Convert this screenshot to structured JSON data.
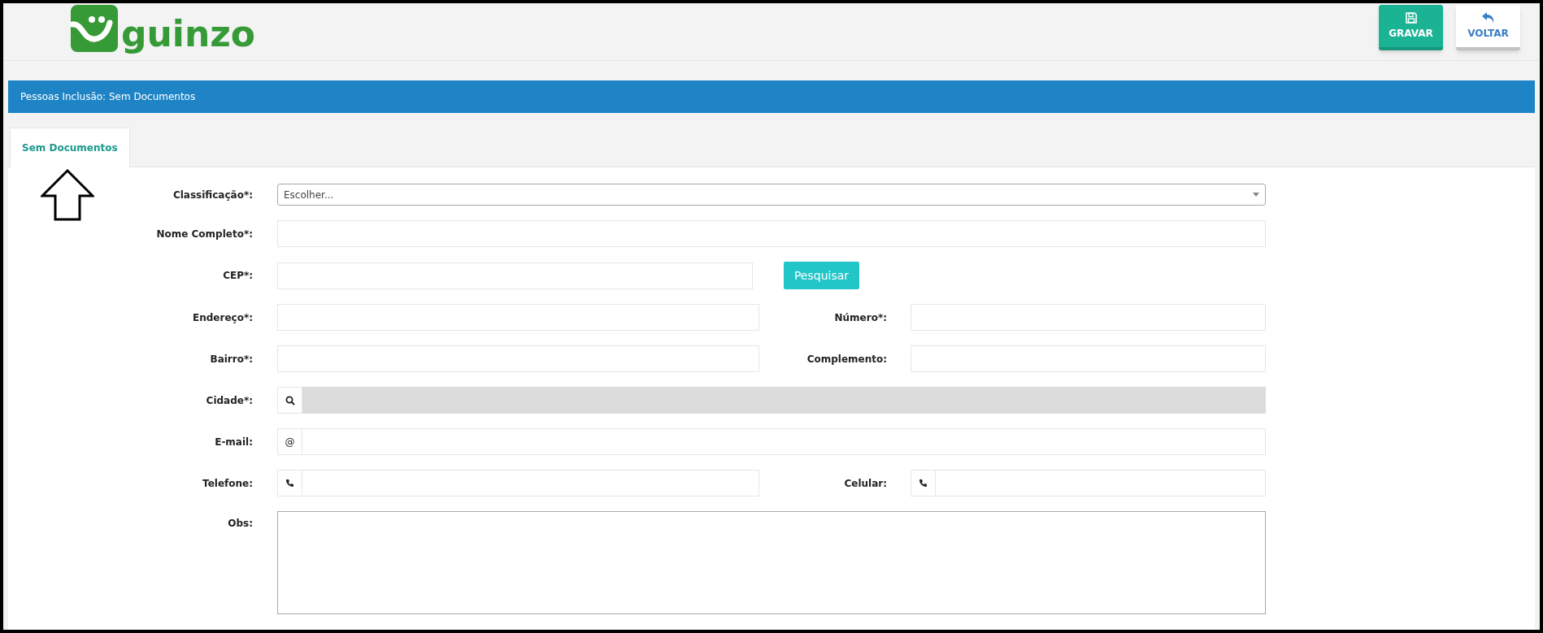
{
  "logo": {
    "text": "guinzo"
  },
  "actions": [
    {
      "kind": "save",
      "label": "GRAVAR"
    },
    {
      "kind": "back",
      "label": "VOLTAR"
    }
  ],
  "page_title": "Pessoas Inclusão: Sem Documentos",
  "tabs": [
    {
      "label": "Sem Documentos",
      "selected": true
    }
  ],
  "form_rows": [
    {
      "fields": [
        {
          "label": "Classificação*:",
          "kind": "select",
          "placeholder": "Escolher...",
          "disabled": false
        }
      ]
    },
    {
      "fields": [
        {
          "label": "Nome Completo*:",
          "kind": "text",
          "disabled": false
        }
      ]
    },
    {
      "fields": [
        {
          "label": "CEP*:",
          "kind": "text",
          "disabled": false,
          "button": "Pesquisar"
        }
      ]
    },
    {
      "fields": [
        {
          "label": "Endereço*:",
          "kind": "text",
          "disabled": false
        },
        {
          "label": "Número*:",
          "kind": "text",
          "disabled": false
        }
      ]
    },
    {
      "fields": [
        {
          "label": "Bairro*:",
          "kind": "text",
          "disabled": false
        },
        {
          "label": "Complemento:",
          "kind": "text",
          "disabled": false
        }
      ]
    },
    {
      "fields": [
        {
          "label": "Cidade*:",
          "kind": "search",
          "disabled": true
        }
      ]
    },
    {
      "fields": [
        {
          "label": "E-mail:",
          "kind": "email",
          "addon": "@",
          "disabled": false
        }
      ]
    },
    {
      "fields": [
        {
          "label": "Telefone:",
          "kind": "phone",
          "disabled": false
        },
        {
          "label": "Celular:",
          "kind": "phone",
          "disabled": false
        }
      ]
    },
    {
      "fields": [
        {
          "label": "Obs:",
          "kind": "textarea",
          "disabled": false
        }
      ]
    }
  ]
}
